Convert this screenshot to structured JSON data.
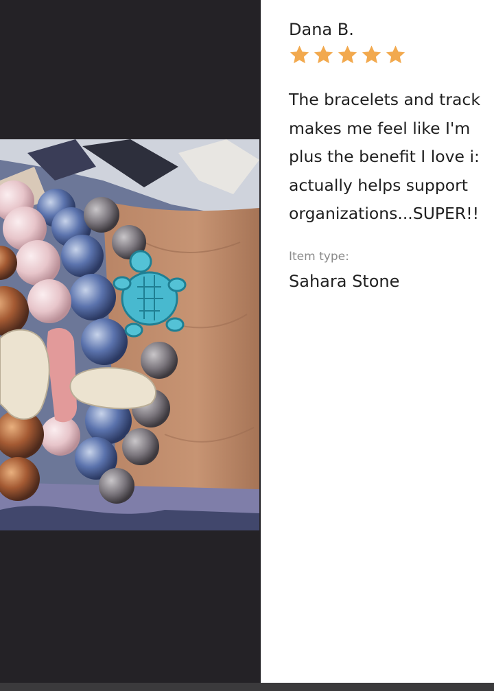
{
  "review": {
    "reviewer_name": "Dana B.",
    "rating": 5,
    "rating_max": 5,
    "text": "The bracelets and track\nmakes me feel like I'm\nplus the benefit I love i:\nactually helps support\norganizations...SUPER!!",
    "item_type_label": "Item type:",
    "item_type_value": "Sahara Stone"
  },
  "colors": {
    "star": "#f2a94e",
    "page_background": "#242226",
    "panel_background": "#ffffff"
  },
  "icons": {
    "star": "star-icon"
  }
}
